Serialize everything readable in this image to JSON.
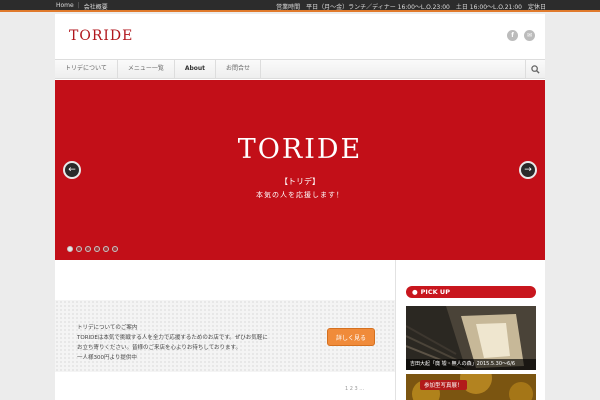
{
  "topbar": {
    "home": "Home",
    "link2": "会社概要",
    "right_text": "営業時間　平日（月〜金）ランチ／ディナー 16:00〜L.O.23:00　土日 16:00〜L.O.21:00　定休日"
  },
  "header": {
    "logo": "TORIDE",
    "social": [
      "f",
      "✉"
    ]
  },
  "nav": {
    "items": [
      "トリデについて",
      "メニュー一覧",
      "About",
      "お問合せ"
    ]
  },
  "slider": {
    "title": "TORIDE",
    "subtitle": "【トリデ】",
    "tagline": "本気の人を応援します！",
    "dots_total": 6,
    "active_dot": 0
  },
  "info": {
    "line1": "トリデについてのご案内",
    "line2": "TORIDEは本気で挑戦する人を全力で応援するためのお店です。ぜひお気軽に",
    "line3": "お立ち寄りください。皆様のご来店を心よりお待ちしております。",
    "line4": "一人様300円より提供中",
    "cta": "詳しく見る",
    "bottom_hint": "1 2 3 …"
  },
  "sidebar": {
    "pickup_label": "PICK UP",
    "item1_caption": "吉田大起「廃 墟・無人の森」2015.5.30〜6/6",
    "item2_badge": "参加型写真展！"
  },
  "colors": {
    "brand_red": "#c20f18",
    "accent_orange": "#f08b3a"
  }
}
